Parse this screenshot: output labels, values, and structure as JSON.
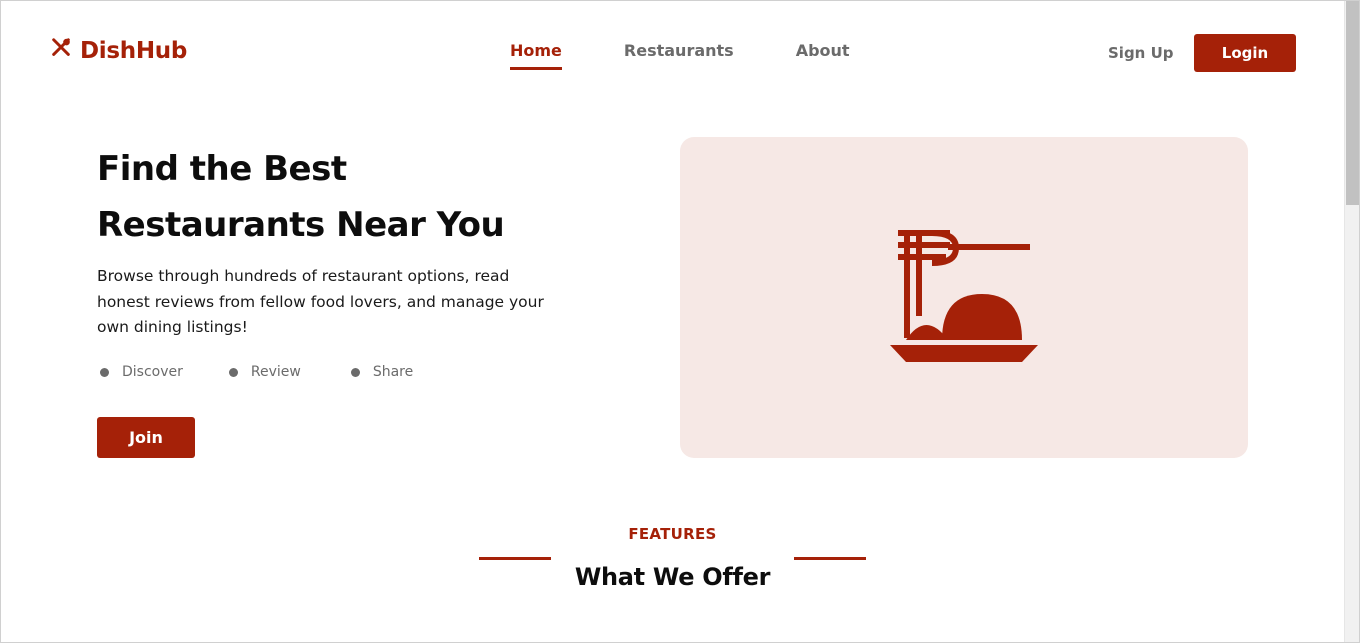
{
  "header": {
    "logo_text": "DishHub",
    "logo_icon": "fork-knife-icon",
    "nav": [
      {
        "label": "Home",
        "active": true
      },
      {
        "label": "Restaurants",
        "active": false
      },
      {
        "label": "About",
        "active": false
      }
    ],
    "signup_label": "Sign Up",
    "login_label": "Login"
  },
  "hero": {
    "title_line1": "Find the Best",
    "title_line2": "Restaurants Near You",
    "description": "Browse through hundreds of restaurant options, read honest reviews from fellow food lovers, and manage your own dining listings!",
    "pills": [
      "Discover",
      "Review",
      "Share"
    ],
    "join_label": "Join",
    "image_icon": "noodle-bowl-icon"
  },
  "features": {
    "label": "FEATURES",
    "title": "What We Offer"
  },
  "colors": {
    "accent": "#a52108",
    "hero_image_bg": "#f6e8e5",
    "muted_text": "#6b6b6b"
  }
}
